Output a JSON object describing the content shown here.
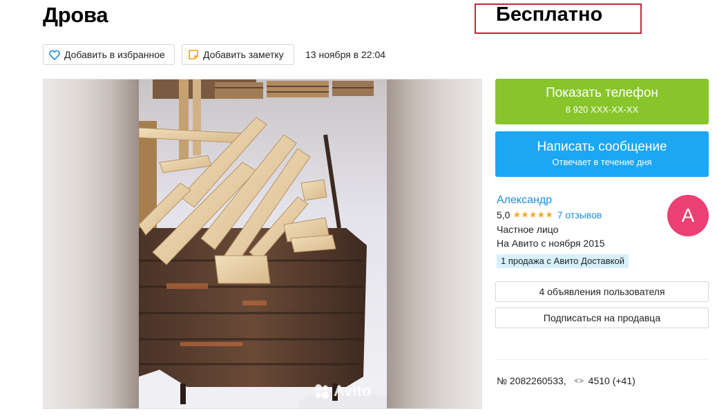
{
  "listing": {
    "title": "Дрова",
    "price": "Бесплатно",
    "date": "13 ноября в 22:04",
    "item_number": "№ 2082260533,",
    "views": "4510 (+41)"
  },
  "actions": {
    "favorite_label": "Добавить в избранное",
    "note_label": "Добавить заметку"
  },
  "gallery": {
    "watermark": "Avito"
  },
  "contact": {
    "phone_label": "Показать телефон",
    "phone_number": "8 920 XXX-XX-XX",
    "message_label": "Написать сообщение",
    "message_sub": "Отвечает в течение дня"
  },
  "seller": {
    "name": "Александр",
    "rating": "5,0",
    "stars": "★★★★★",
    "reviews": "7 отзывов",
    "type": "Частное лицо",
    "since": "На Авито с ноября 2015",
    "badge": "1 продажа с Авито Доставкой",
    "avatar_letter": "A",
    "ads_label": "4 объявления пользователя",
    "subscribe_label": "Подписаться на продавца"
  },
  "colors": {
    "phone_button": "#87c52b",
    "message_button": "#1ba7f4",
    "avatar": "#ec3f72",
    "link": "#1a8fd8",
    "price_highlight": "#c8233b"
  },
  "icons": [
    "heart-icon",
    "note-icon",
    "eye-icon",
    "avito-logo-icon"
  ]
}
